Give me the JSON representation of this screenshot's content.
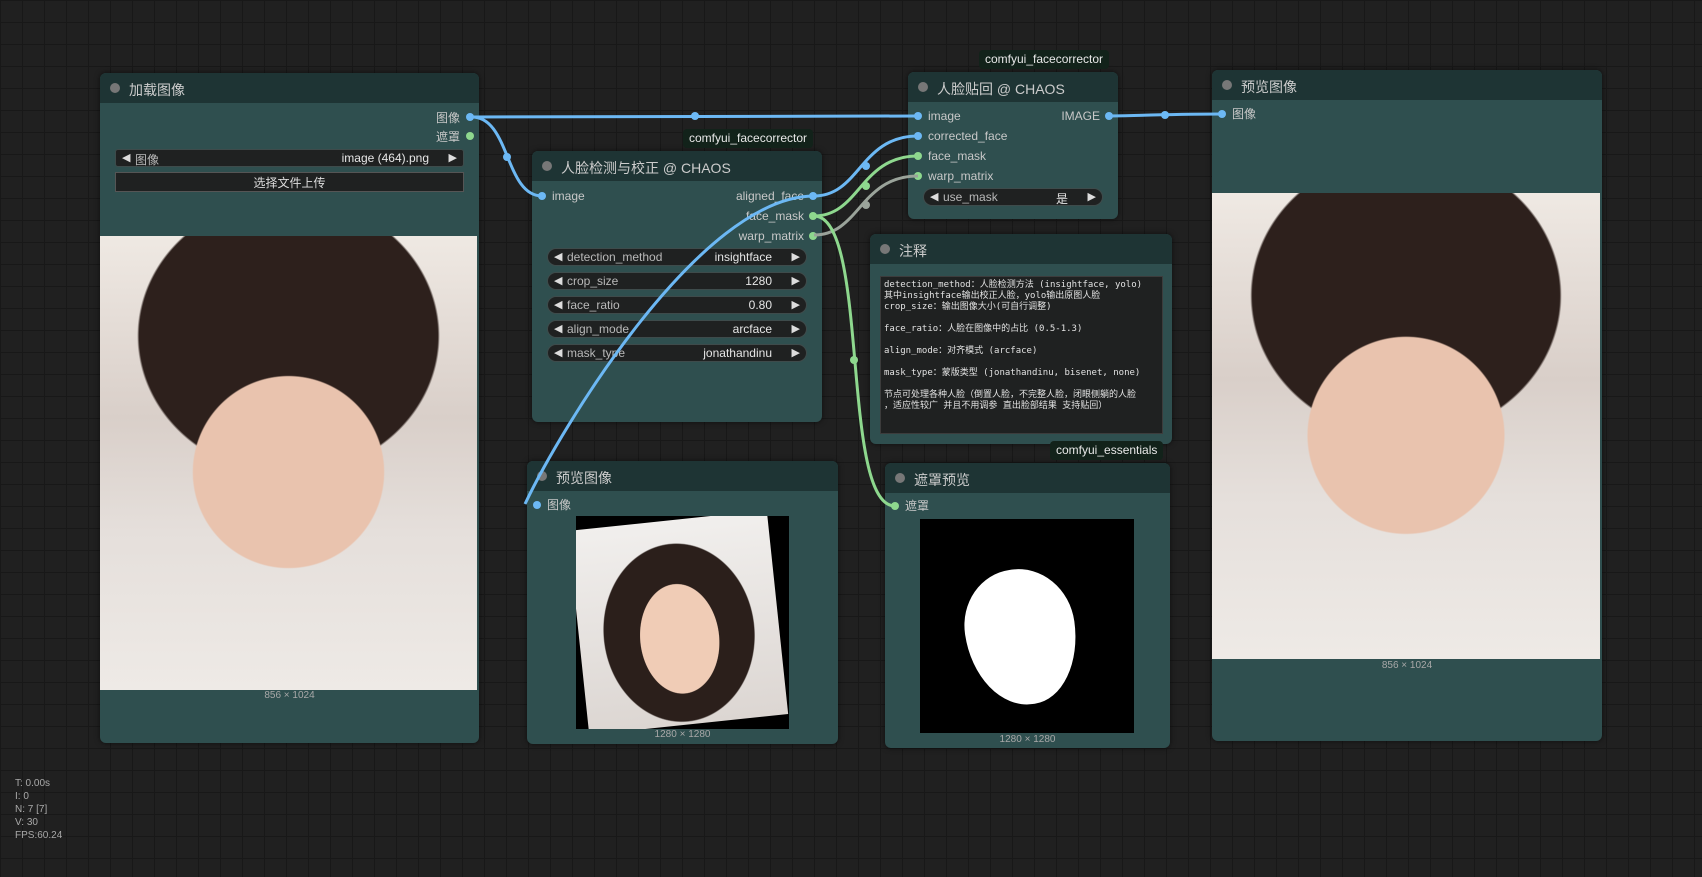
{
  "nodes": {
    "load_image": {
      "title": "加载图像",
      "outputs": [
        "图像",
        "遮罩"
      ],
      "widget_label": "图像",
      "widget_value": "image (464).png",
      "upload_button": "选择文件上传",
      "image_size": "856 × 1024"
    },
    "face_detect": {
      "badge": "comfyui_facecorrector",
      "title": "人脸检测与校正 @ CHAOS",
      "inputs": [
        "image"
      ],
      "outputs": [
        "aligned_face",
        "face_mask",
        "warp_matrix"
      ],
      "widgets": [
        {
          "label": "detection_method",
          "value": "insightface"
        },
        {
          "label": "crop_size",
          "value": "1280"
        },
        {
          "label": "face_ratio",
          "value": "0.80"
        },
        {
          "label": "align_mode",
          "value": "arcface"
        },
        {
          "label": "mask_type",
          "value": "jonathandinu"
        }
      ]
    },
    "face_paste": {
      "badge": "comfyui_facecorrector",
      "title": "人脸贴回 @ CHAOS",
      "inputs": [
        "image",
        "corrected_face",
        "face_mask",
        "warp_matrix"
      ],
      "output": "IMAGE",
      "widget_label": "use_mask",
      "widget_value": "是"
    },
    "preview_right": {
      "title": "预览图像",
      "input": "图像",
      "image_size": "856 × 1024"
    },
    "notes": {
      "title": "注释",
      "text": "detection_method：人脸检测方法 (insightface, yolo)\n其中insightface输出校正人脸，yolo输出原图人脸\ncrop_size：输出图像大小(可自行调整)\n\nface_ratio：人脸在图像中的占比 (0.5-1.3)\n\nalign_mode：对齐模式 (arcface)\n\nmask_type：蒙版类型 (jonathandinu, bisenet, none)\n\n节点可处理各种人脸（倒置人脸，不完整人脸，闭眼侧躺的人脸\n，适应性较广 并且不用调参 直出脸部结果 支持贴回）"
    },
    "preview_mid": {
      "title": "预览图像",
      "input": "图像",
      "image_size": "1280 × 1280"
    },
    "mask_preview": {
      "badge": "comfyui_essentials",
      "title": "遮罩预览",
      "input": "遮罩",
      "image_size": "1280 × 1280"
    }
  },
  "colors": {
    "image_wire": "#6cb8f4",
    "mask_wire": "#8ed88e",
    "matrix_wire": "#9aa39a",
    "node_body": "#2f4f4f",
    "node_title": "#1e3434"
  },
  "stats": [
    "T: 0.00s",
    "I: 0",
    "N: 7 [7]",
    "V: 30",
    "FPS:60.24"
  ]
}
